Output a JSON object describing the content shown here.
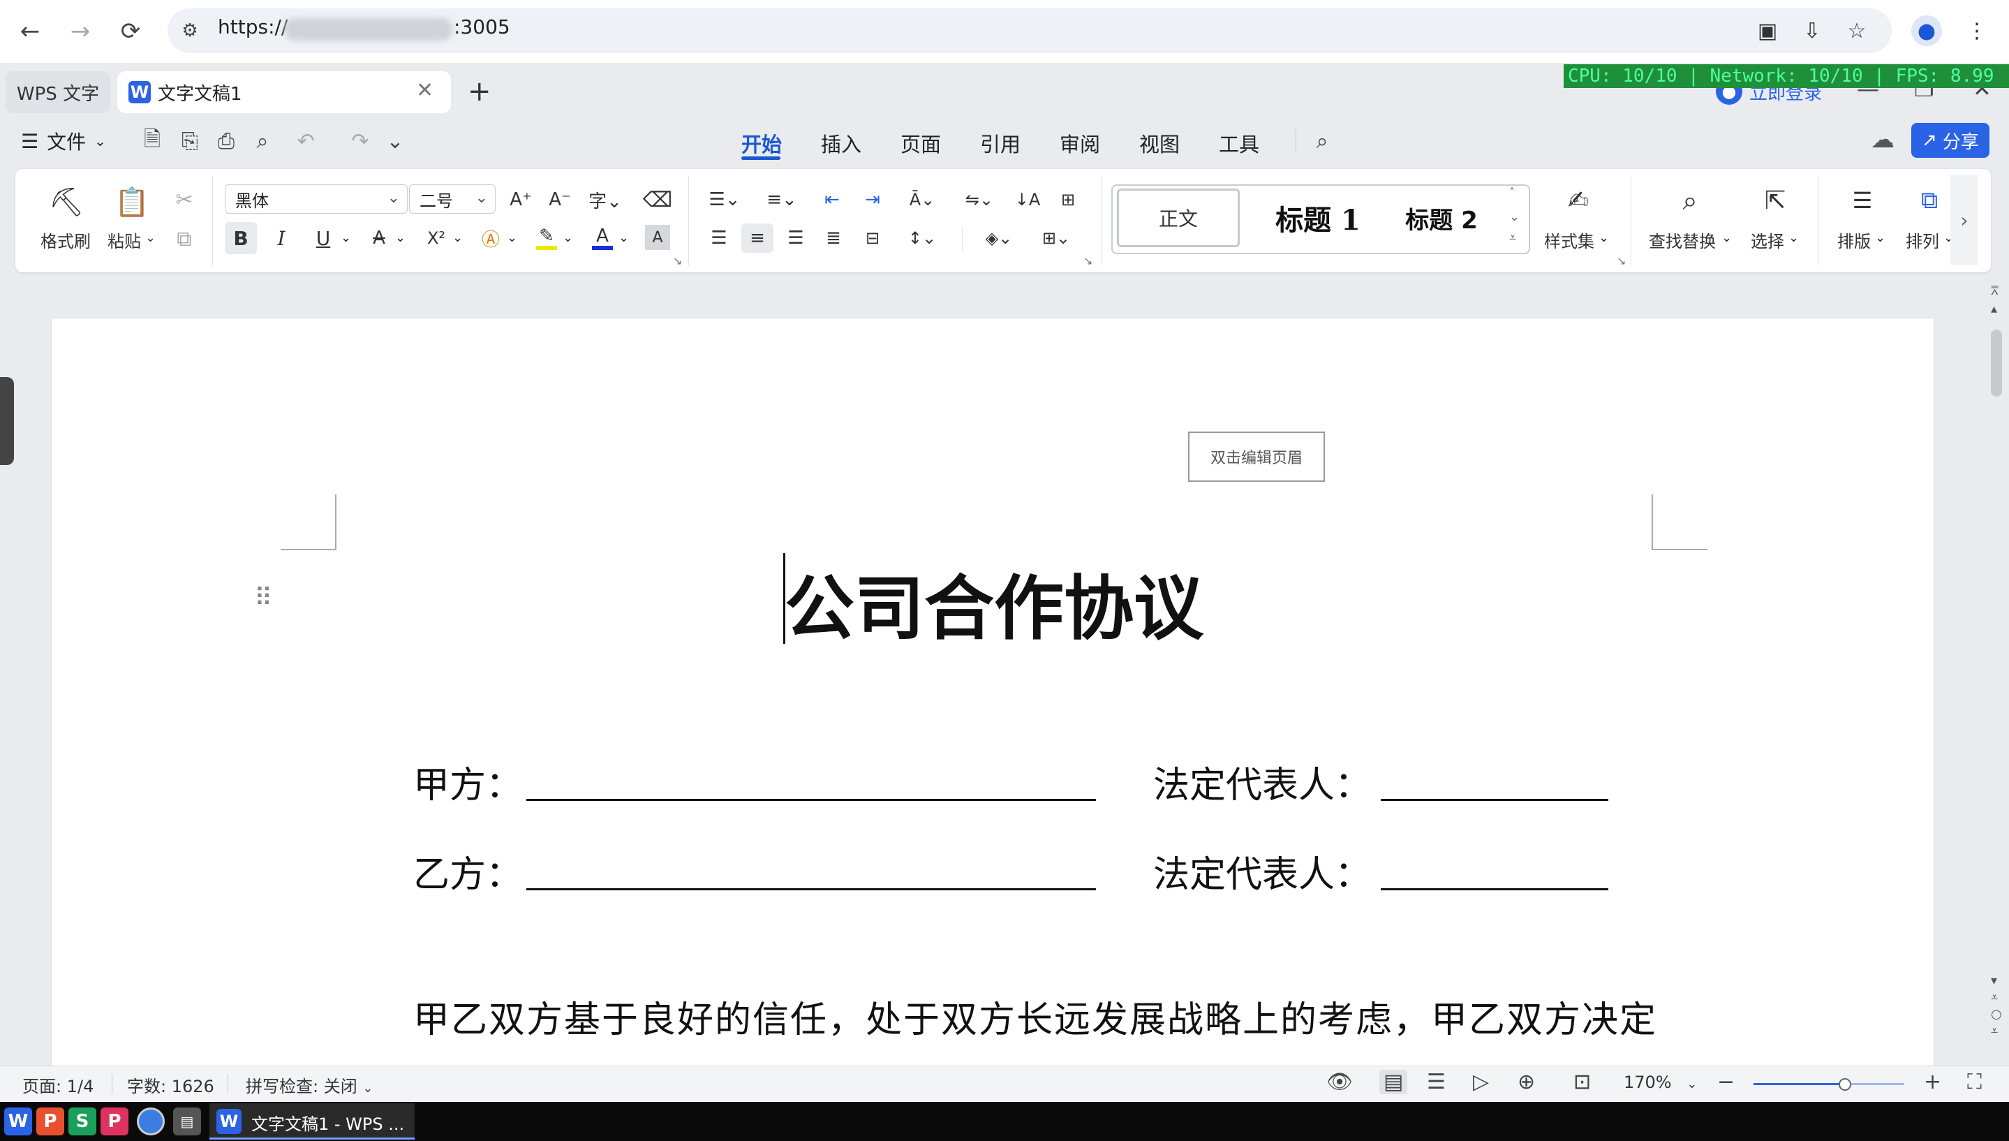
{
  "browser": {
    "url_prefix": "https://",
    "url_port": ":3005"
  },
  "tabs": {
    "app_tab": "WPS 文字",
    "doc_tab": "文字文稿1",
    "doc_tab_icon": "W"
  },
  "perf": "CPU: 10/10 | Network: 10/10 | FPS: 8.99",
  "login": "立即登录",
  "menu": {
    "file": "文件",
    "tabs": [
      "开始",
      "插入",
      "页面",
      "引用",
      "审阅",
      "视图",
      "工具"
    ],
    "share": "分享"
  },
  "ribbon": {
    "format_painter": "格式刷",
    "paste": "粘贴",
    "font": "黑体",
    "size": "二号",
    "styles": [
      "正文",
      "标题 1",
      "标题 2"
    ],
    "style_set": "样式集",
    "find_replace": "查找替换",
    "select": "选择",
    "layout": "排版",
    "arrange": "排列",
    "font_size_up": "A⁺",
    "font_size_down": "A⁻",
    "bold": "B",
    "italic": "I",
    "underline": "U",
    "strikethrough": "A",
    "superscript": "X²",
    "char_shading": "A"
  },
  "document": {
    "header_hint": "双击编辑页眉",
    "title": "公司合作协议",
    "party_a": "甲方：",
    "party_b": "乙方：",
    "legal_rep": "法定代表人：",
    "body_line": "甲乙双方基于良好的信任，处于双方长远发展战略上的考虑，甲乙双方决定"
  },
  "status": {
    "page": "页面: 1/4",
    "words": "字数: 1626",
    "spell": "拼写检查: 关闭",
    "zoom": "170%",
    "zoom_slider_fraction": 0.6
  },
  "taskbar": {
    "apps": [
      {
        "letter": "W",
        "color": "#2b63e6"
      },
      {
        "letter": "P",
        "color": "#e8502f"
      },
      {
        "letter": "S",
        "color": "#1aa05a"
      },
      {
        "letter": "P",
        "color": "#e0325f"
      }
    ],
    "window_label": "文字文稿1 - WPS ..."
  },
  "colors": {
    "accent": "#2b63e6",
    "highlight_yellow": "#f2e600",
    "font_color_blue": "#1c2fd6"
  }
}
